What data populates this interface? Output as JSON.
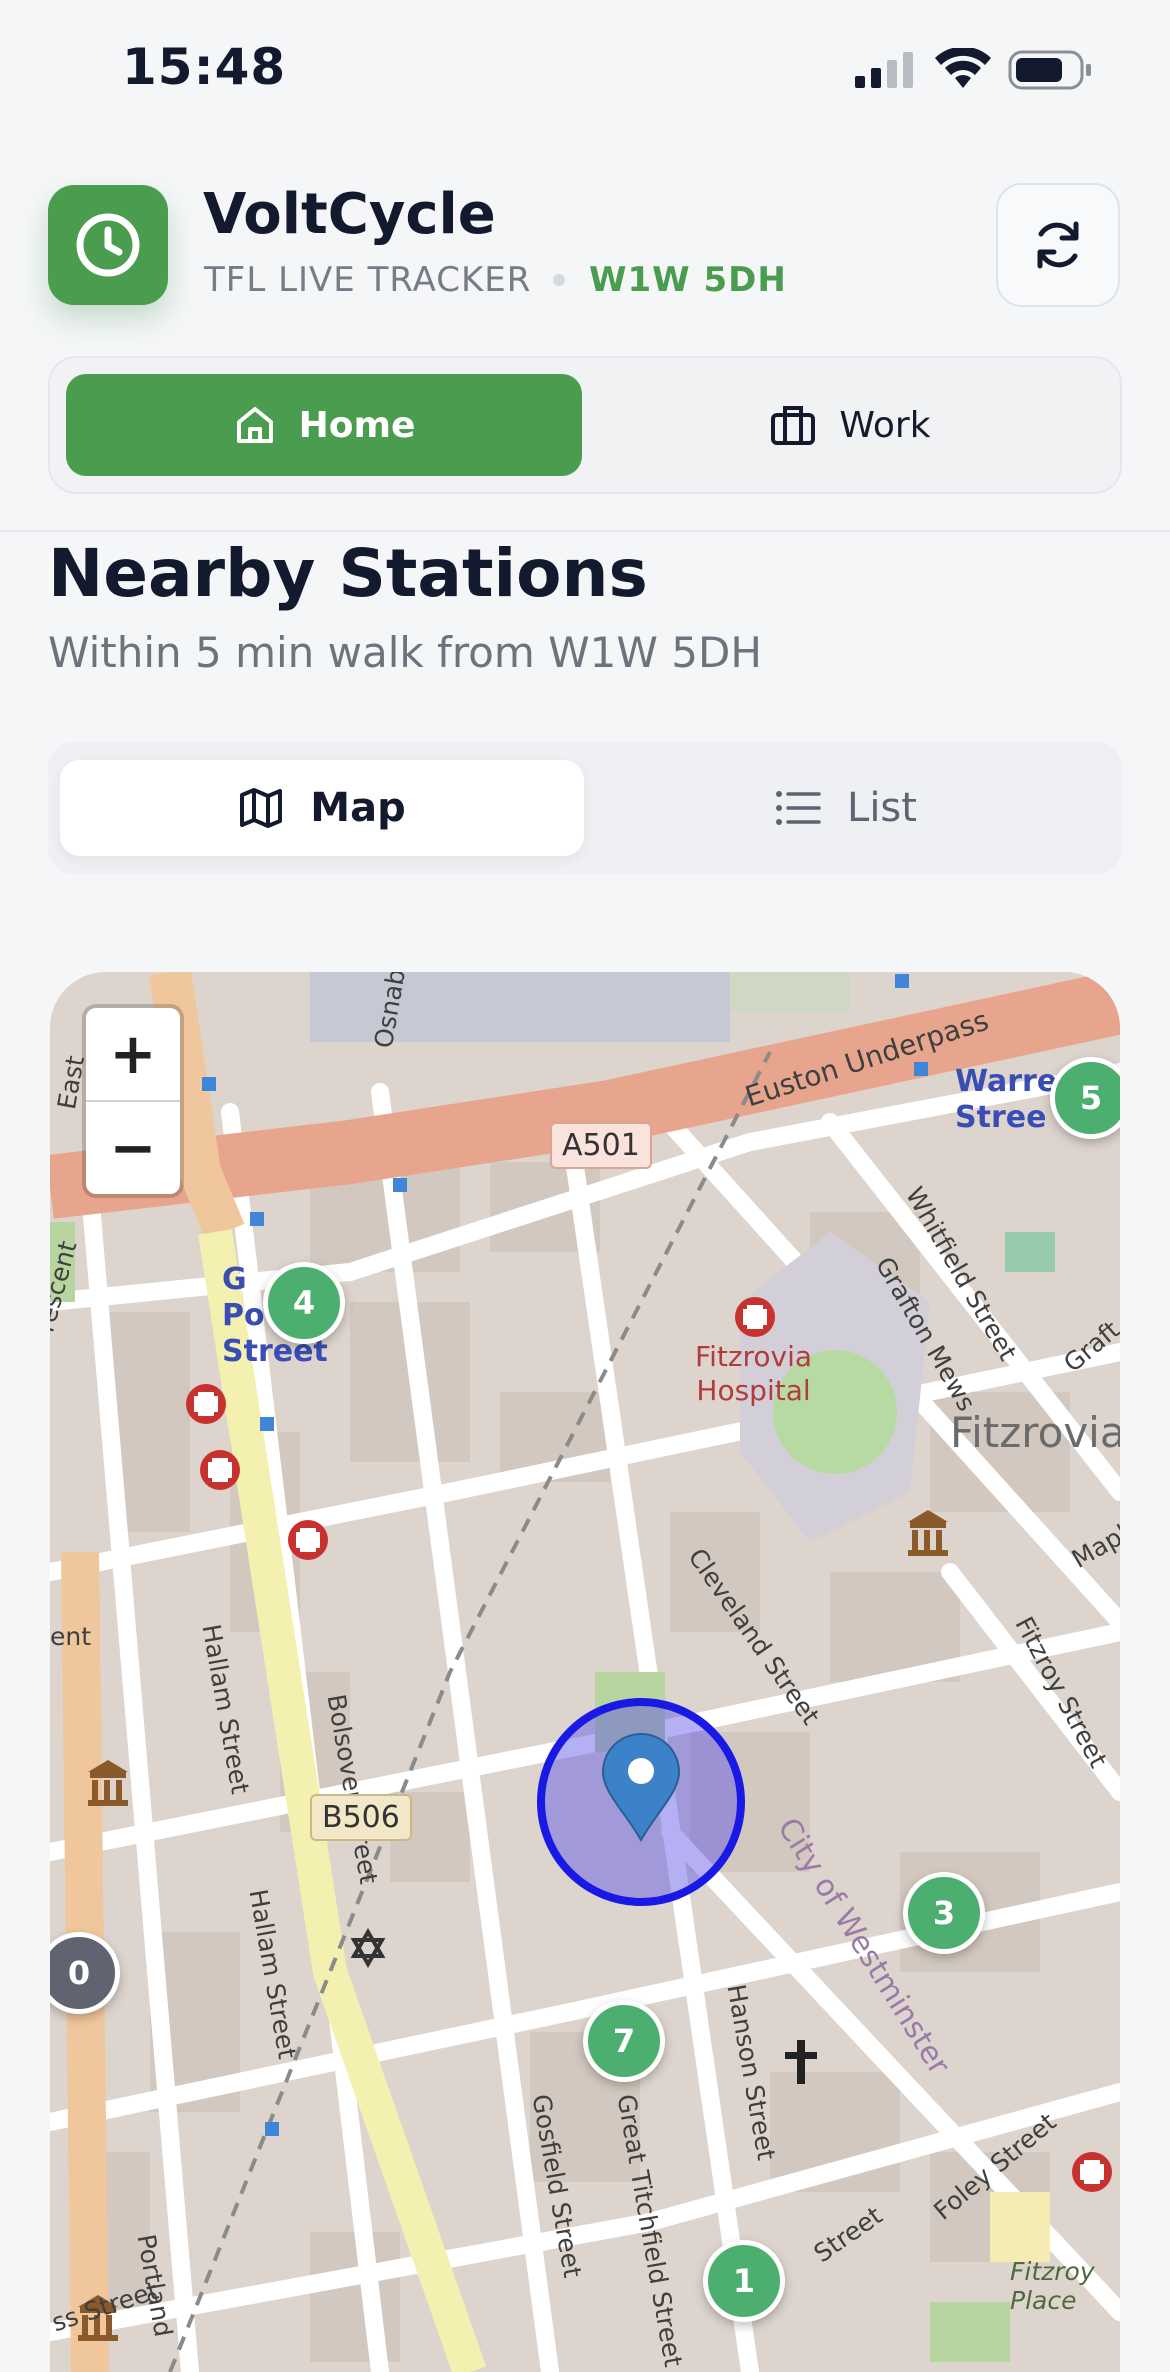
{
  "status_bar": {
    "time": "15:48"
  },
  "header": {
    "app_name": "VoltCycle",
    "subtitle": "TFL LIVE TRACKER",
    "postcode": "W1W 5DH",
    "brand_color": "#4a9d4e"
  },
  "location_tabs": [
    {
      "label": "Home",
      "icon": "home-icon",
      "selected": true
    },
    {
      "label": "Work",
      "icon": "briefcase-icon",
      "selected": false
    }
  ],
  "section": {
    "title": "Nearby Stations",
    "subtitle": "Within 5 min walk from W1W 5DH"
  },
  "view_tabs": [
    {
      "label": "Map",
      "icon": "map-icon",
      "selected": true
    },
    {
      "label": "List",
      "icon": "list-icon",
      "selected": false
    }
  ],
  "map": {
    "zoom_in": "+",
    "zoom_out": "−",
    "markers": [
      {
        "count": "5",
        "color": "#4caf6f"
      },
      {
        "count": "4",
        "color": "#4caf6f"
      },
      {
        "count": "3",
        "color": "#4caf6f"
      },
      {
        "count": "0",
        "color": "#5f6470"
      },
      {
        "count": "7",
        "color": "#4caf6f"
      },
      {
        "count": "1",
        "color": "#4caf6f"
      }
    ],
    "labels": {
      "euston_underpass": "Euston Underpass",
      "a501": "A501",
      "b506": "B506",
      "warren_street": "Warre\nStree",
      "great_portland_street": "G\nPo     d\nStreet",
      "fitzrovia_hospital": "Fitzrovia\nHospital",
      "fitzrovia": "Fitzrovia",
      "cleveland_street": "Cleveland Street",
      "bolsover_street": "Bolsover Street",
      "hallam_street_1": "Hallam Street",
      "hallam_street_2": "Hallam Street",
      "whitfield_street": "Whitfield Street",
      "grafton_mews": "Grafton Mews",
      "grafton": "Graft",
      "fitzroy_street": "Fitzroy Street",
      "maple": "Mapl",
      "city_of_westminster": "City of Westminster",
      "gosfield_street": "Gosfield Street",
      "great_titchfield_street": "Great Titchfield Street",
      "hanson_street": "Hanson Street",
      "foley_street": "Foley Street",
      "street": "Street",
      "fitzroy_place": "Fitzroy\nPlace",
      "portland": "Portland",
      "ss_street": "ss Street",
      "crescent": "rescent",
      "east": "East",
      "ent": "ent",
      "osnab": "Osnab"
    }
  }
}
